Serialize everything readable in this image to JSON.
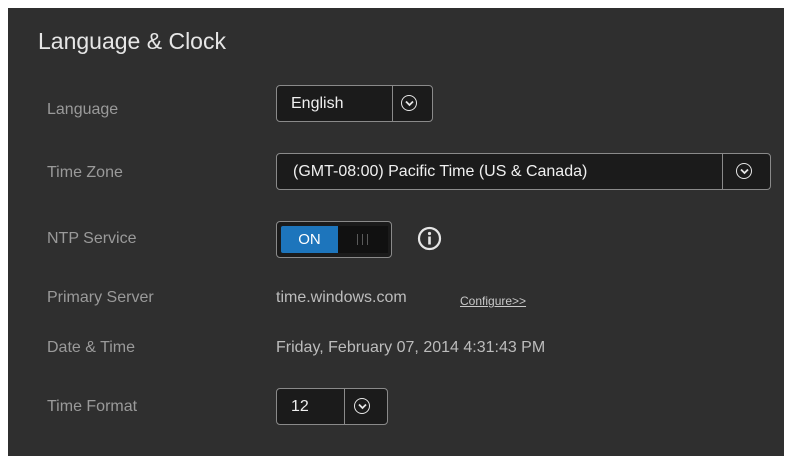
{
  "panel": {
    "title": "Language & Clock"
  },
  "language": {
    "label": "Language",
    "value": "English"
  },
  "time_zone": {
    "label": "Time Zone",
    "value": "(GMT-08:00) Pacific Time (US & Canada)"
  },
  "ntp_service": {
    "label": "NTP Service",
    "toggle_on_label": "ON",
    "state": "on",
    "info_icon": "info-icon"
  },
  "primary_server": {
    "label": "Primary Server",
    "value": "time.windows.com",
    "configure_link": "Configure>>"
  },
  "date_time": {
    "label": "Date & Time",
    "value": "Friday, February 07, 2014 4:31:43 PM"
  },
  "time_format": {
    "label": "Time Format",
    "value": "12"
  },
  "colors": {
    "panel_bg": "#2f2f2f",
    "accent": "#1d75bc",
    "label": "#9a9a9a",
    "field_bg": "#1b1b1b"
  }
}
